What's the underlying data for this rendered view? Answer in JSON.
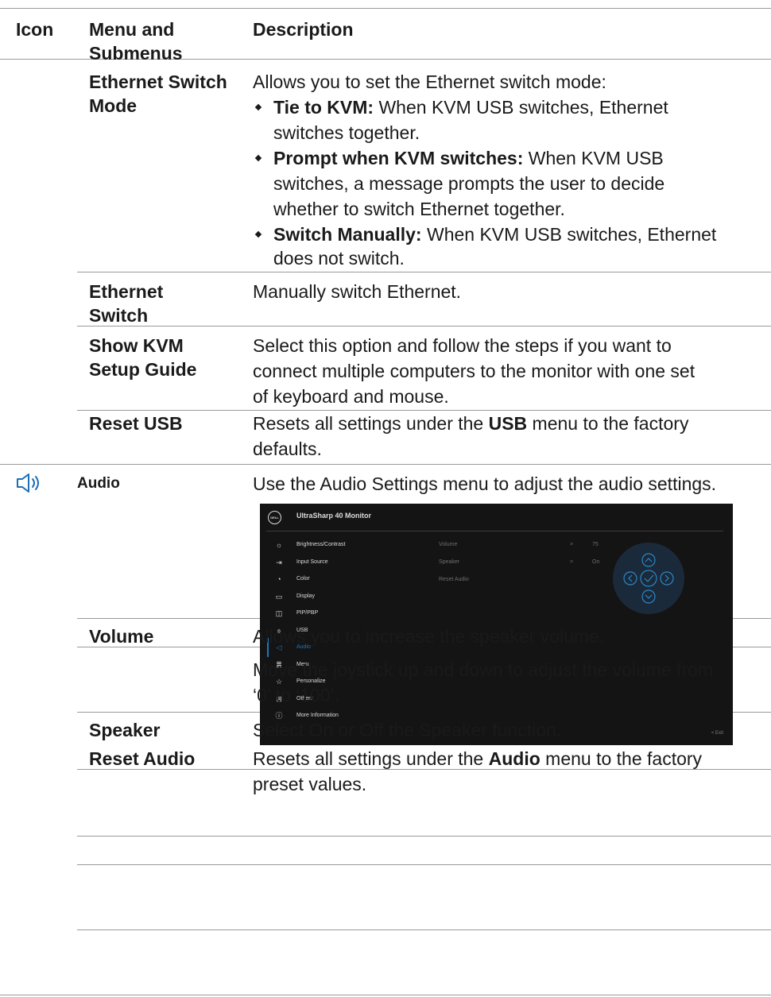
{
  "header": {
    "icon": "Icon",
    "menu": "Menu and Submenus",
    "description": "Description"
  },
  "ethernet_switch_mode": {
    "menu": "Ethernet Switch Mode",
    "intro": "Allows you to set the Ethernet switch mode:",
    "bullets": [
      {
        "term": "Tie to KVM:",
        "text": " When KVM USB switches, Ethernet",
        "cont": "switches together."
      },
      {
        "term": "Prompt when KVM switches:",
        "text": " When KVM USB",
        "cont1": "switches, a message prompts the user to decide",
        "cont2": "whether to switch Ethernet together."
      },
      {
        "term": "Switch Manually:",
        "text": " When KVM USB switches, Ethernet",
        "cont": "does not switch."
      }
    ]
  },
  "ethernet_switch": {
    "menu": "Ethernet Switch",
    "desc": "Manually switch Ethernet."
  },
  "show_kvm": {
    "menu": "Show KVM Setup Guide",
    "desc1": "Select this option and follow the steps if you want to",
    "desc2": "connect multiple computers to the monitor with one set",
    "desc3": "of keyboard and mouse."
  },
  "reset_usb": {
    "menu": "Reset USB",
    "desc_pre": "Resets all settings under the ",
    "desc_bold": "USB",
    "desc_post": " menu to the factory",
    "desc2": "defaults."
  },
  "audio": {
    "icon": "speaker-icon",
    "menu": "Audio",
    "desc": "Use the Audio Settings menu to adjust the audio settings."
  },
  "osd": {
    "logo": "DELL",
    "title": "UltraSharp 40 Monitor",
    "items": [
      {
        "icon": "brightness-icon",
        "glyph": "☼",
        "label": "Brightness/Contrast"
      },
      {
        "icon": "input-source-icon",
        "glyph": "⇥",
        "label": "Input Source"
      },
      {
        "icon": "color-icon",
        "glyph": "◔",
        "label": "Color"
      },
      {
        "icon": "display-icon",
        "glyph": "▭",
        "label": "Display"
      },
      {
        "icon": "pip-pbp-icon",
        "glyph": "◫",
        "label": "PIP/PBP"
      },
      {
        "icon": "usb-icon",
        "glyph": "⌽",
        "label": "USB"
      },
      {
        "icon": "audio-icon",
        "glyph": "◁",
        "label": "Audio"
      },
      {
        "icon": "menu-icon",
        "glyph": "≣",
        "label": "Menu"
      },
      {
        "icon": "personalize-icon",
        "glyph": "☆",
        "label": "Personalize"
      },
      {
        "icon": "others-icon",
        "glyph": "⊞",
        "label": "Others"
      },
      {
        "icon": "info-icon",
        "glyph": "ⓘ",
        "label": "More Information"
      }
    ],
    "active_index": 6,
    "submenu": [
      {
        "label": "Volume",
        "arrow": ">",
        "value": "75"
      },
      {
        "label": "Speaker",
        "arrow": ">",
        "value": "On"
      },
      {
        "label": "Reset Audio",
        "arrow": "",
        "value": ""
      }
    ],
    "exit": "< Exit"
  },
  "volume": {
    "menu": "Volume",
    "desc1": "Allows you to increase the speaker volume.",
    "desc2a": "Move the joystick up and down to adjust the volume from",
    "desc2b": "‘0’ to ‘100’."
  },
  "speaker": {
    "menu": "Speaker",
    "desc": "Select On or Off the Speaker function."
  },
  "reset_audio": {
    "menu": "Reset Audio",
    "desc_pre": "Resets all settings under the ",
    "desc_bold": "Audio",
    "desc_post": " menu to the factory",
    "desc2": "preset values."
  }
}
